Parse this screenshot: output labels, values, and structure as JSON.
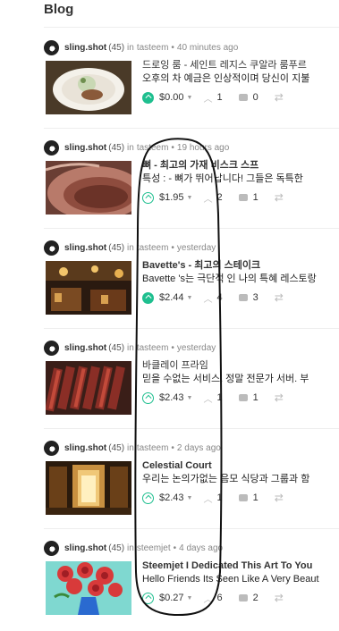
{
  "page": {
    "title": "Blog"
  },
  "posts": [
    {
      "author": "sling.shot",
      "rep": "(45)",
      "in_label": "in",
      "community": "tasteem",
      "time": "40 minutes ago",
      "title": "드로잉 룸 - 세인트 레지스 쿠알라 룸푸르",
      "title_bold": false,
      "excerpt": "오후의 차 예금은 인상적이며 당신이 지불",
      "payout": "$0.00",
      "votes": "1",
      "comments": "0",
      "upvoted": true
    },
    {
      "author": "sling.shot",
      "rep": "(45)",
      "in_label": "in",
      "community": "tasteem",
      "time": "19 hours ago",
      "title": "뼈 - 최고의 가재 비스크 스프",
      "title_bold": true,
      "excerpt": "특성 : - 뼈가 뛰어납니다! 그들은 독특한",
      "payout": "$1.95",
      "votes": "2",
      "comments": "1",
      "upvoted": false
    },
    {
      "author": "sling.shot",
      "rep": "(45)",
      "in_label": "in",
      "community": "tasteem",
      "time": "yesterday",
      "title": "Bavette's - 최고의 스테이크",
      "title_bold": true,
      "excerpt": "Bavette 's는 극단적 인 나의 특혜 레스토랑",
      "payout": "$2.44",
      "votes": "4",
      "comments": "3",
      "upvoted": true
    },
    {
      "author": "sling.shot",
      "rep": "(45)",
      "in_label": "in",
      "community": "tasteem",
      "time": "yesterday",
      "title": "바클레이 프라임",
      "title_bold": false,
      "excerpt": "믿을 수없는 서비스. 정말 전문가 서버. 부",
      "payout": "$2.43",
      "votes": "1",
      "comments": "1",
      "upvoted": false
    },
    {
      "author": "sling.shot",
      "rep": "(45)",
      "in_label": "in",
      "community": "tasteem",
      "time": "2 days ago",
      "title": "Celestial Court",
      "title_bold": true,
      "excerpt": "우리는 논의가없는 음모 식당과 그룹과 함",
      "payout": "$2.43",
      "votes": "1",
      "comments": "1",
      "upvoted": false
    },
    {
      "author": "sling.shot",
      "rep": "(45)",
      "in_label": "in",
      "community": "steemjet",
      "time": "4 days ago",
      "title": "Steemjet I Dedicated This Art To You",
      "title_bold": true,
      "excerpt": "Hello Friends Its Seen Like A Very Beaut",
      "payout": "$0.27",
      "votes": "6",
      "comments": "2",
      "upvoted": false
    }
  ],
  "icons": {
    "upvote": "upvote-circle-icon",
    "caret": "caret-down-icon",
    "vote_count": "chevron-up-icon",
    "comment": "comment-bubble-icon",
    "resteem": "resteem-icon"
  },
  "colors": {
    "accent": "#1fbf8f",
    "text": "#333333",
    "muted": "#888888"
  }
}
